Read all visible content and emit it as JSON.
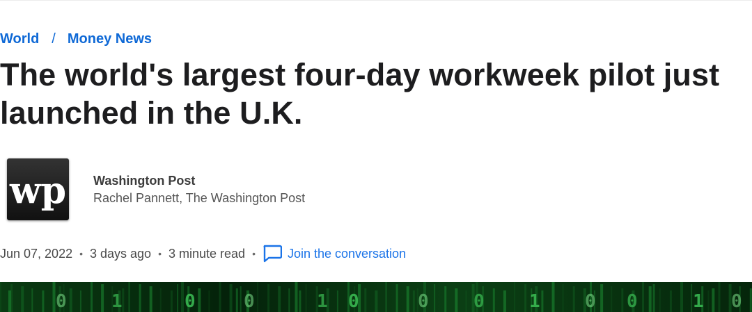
{
  "breadcrumb": {
    "items": [
      "World",
      "Money News"
    ],
    "separator": "/"
  },
  "headline": "The world's largest four-day workweek pilot just launched in the U.K.",
  "byline": {
    "publisher": "Washington Post",
    "author": "Rachel Pannett, The Washington Post",
    "logo_text": "wp"
  },
  "meta": {
    "date": "Jun 07, 2022",
    "relative_time": "3 days ago",
    "read_time": "3 minute read",
    "separator": "•",
    "comment_link": "Join the conversation",
    "comment_icon": "comment-bubble-icon"
  },
  "hero_image": {
    "description_icon": "matrix-digital-rain-image",
    "digits": [
      "0",
      "1",
      "0",
      "0",
      "1",
      "0",
      "0",
      "0",
      "1",
      "0",
      "0",
      "1",
      "0"
    ]
  },
  "colors": {
    "link": "#0f69d6",
    "headline": "#1d1d1f",
    "hero_green": "#1f9e3a"
  }
}
